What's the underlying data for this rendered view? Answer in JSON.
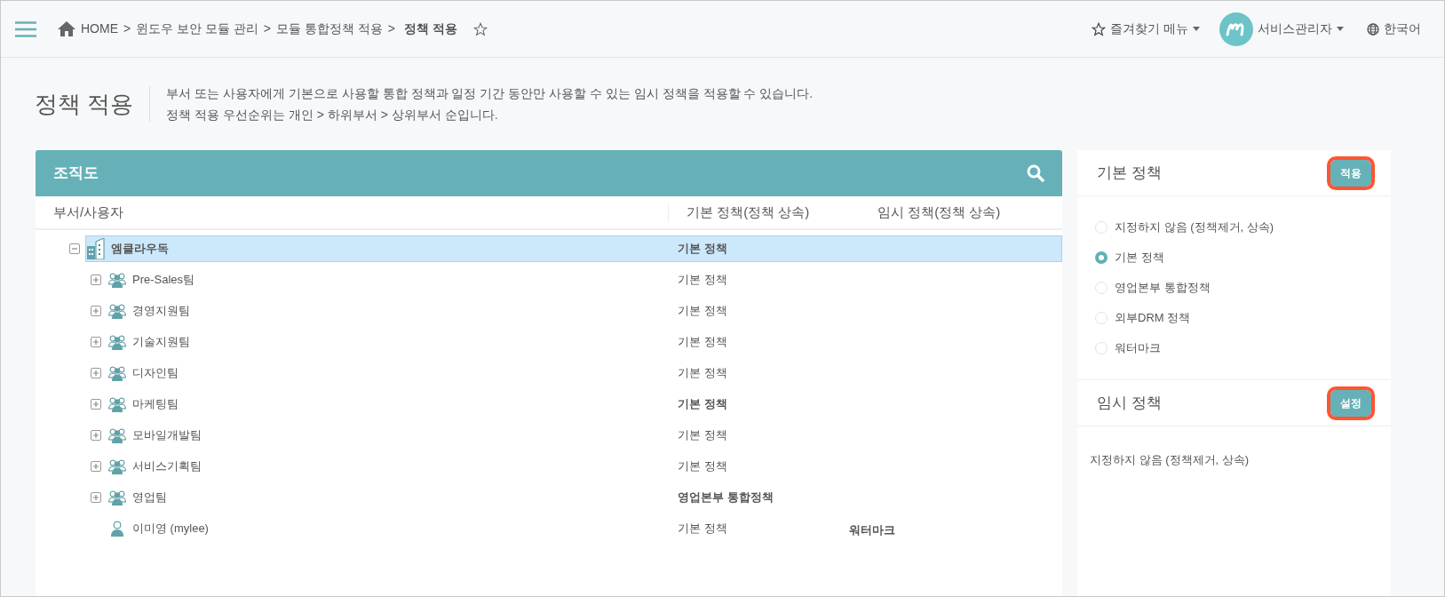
{
  "header": {
    "breadcrumb": [
      "HOME",
      "윈도우 보안 모듈 관리",
      "모듈 통합정책 적용",
      "정책 적용"
    ],
    "separator": ">",
    "favorites_menu": "즐겨찾기 메뉴",
    "user_menu": "서비스관리자",
    "language_menu": "한국어"
  },
  "page": {
    "title": "정책 적용",
    "description": [
      "부서 또는 사용자에게 기본으로 사용할 통합 정책과 일정 기간 동안만 사용할 수 있는 임시 정책을 적용할 수 있습니다.",
      "정책 적용 우선순위는 개인 > 하위부서 > 상위부서 순입니다."
    ]
  },
  "org_panel": {
    "title": "조직도",
    "columns": [
      "부서/사용자",
      "기본 정책(정책 상속)",
      "임시 정책(정책 상속)"
    ],
    "tree": [
      {
        "name": "엠클라우독",
        "kind": "company",
        "expanded": true,
        "selected": true,
        "base_policy": {
          "text": "기본 정책",
          "bold": true
        },
        "children": [
          {
            "name": "Pre-Sales팀",
            "kind": "team",
            "expanded": false,
            "selected": false,
            "base_policy": {
              "text": "기본 정책",
              "bold": false
            }
          },
          {
            "name": "경영지원팀",
            "kind": "team",
            "expanded": false,
            "selected": false,
            "base_policy": {
              "text": "기본 정책",
              "bold": false
            }
          },
          {
            "name": "기술지원팀",
            "kind": "team",
            "expanded": false,
            "selected": false,
            "base_policy": {
              "text": "기본 정책",
              "bold": false
            }
          },
          {
            "name": "디자인팀",
            "kind": "team",
            "expanded": false,
            "selected": false,
            "base_policy": {
              "text": "기본 정책",
              "bold": false
            }
          },
          {
            "name": "마케팅팀",
            "kind": "team",
            "expanded": false,
            "selected": false,
            "base_policy": {
              "text": "기본 정책",
              "bold": true
            }
          },
          {
            "name": "모바일개발팀",
            "kind": "team",
            "expanded": false,
            "selected": false,
            "base_policy": {
              "text": "기본 정책",
              "bold": false
            }
          },
          {
            "name": "서비스기획팀",
            "kind": "team",
            "expanded": false,
            "selected": false,
            "base_policy": {
              "text": "기본 정책",
              "bold": false
            }
          },
          {
            "name": "영업팀",
            "kind": "team",
            "expanded": false,
            "selected": false,
            "base_policy": {
              "text": "영업본부 통합정책",
              "bold": true
            }
          },
          {
            "name": "이미영 (mylee)",
            "kind": "person",
            "selected": false,
            "base_policy": {
              "text": "기본 정책",
              "bold": false
            },
            "temp_policy": {
              "text": "워터마크",
              "bold": true
            }
          }
        ]
      }
    ]
  },
  "base_policy_panel": {
    "title": "기본 정책",
    "button": {
      "label": "적용",
      "highlighted": true
    },
    "options": [
      {
        "label": "지정하지 않음 (정책제거, 상속)",
        "selected": false
      },
      {
        "label": "기본 정책",
        "selected": true
      },
      {
        "label": "영업본부 통합정책",
        "selected": false
      },
      {
        "label": "외부DRM 정책",
        "selected": false
      },
      {
        "label": "워터마크",
        "selected": false
      }
    ]
  },
  "temp_policy_panel": {
    "title": "임시 정책",
    "button": {
      "label": "설정",
      "highlighted": true
    },
    "value": "지정하지 않음 (정책제거, 상속)"
  }
}
